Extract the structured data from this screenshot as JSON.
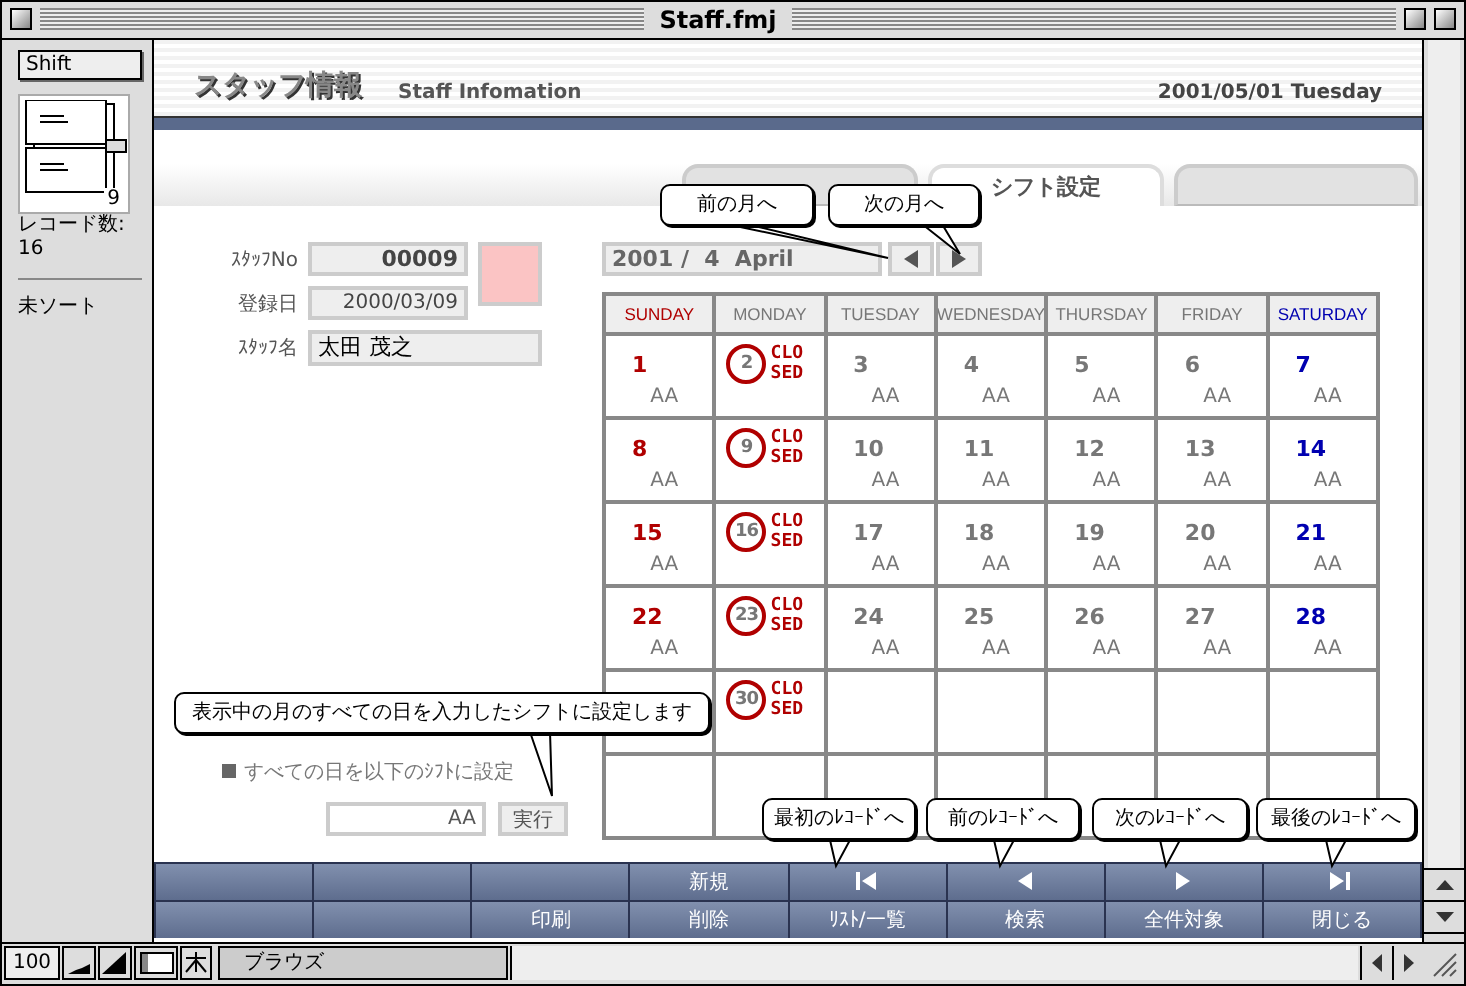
{
  "window": {
    "title": "Staff.fmj"
  },
  "status_area": {
    "layout": "Shift",
    "record": "9",
    "record_count_label": "レコード数:",
    "record_count": "16",
    "sort_status": "未ソート"
  },
  "header": {
    "title": "スタッフ情報",
    "subtitle": "Staff Infomation",
    "date": "2001/05/01 Tuesday"
  },
  "tabs": [
    {
      "selected": false
    },
    {
      "label": "シフト設定",
      "selected": true
    },
    {
      "selected": false
    }
  ],
  "form": {
    "fields": [
      {
        "kind": "id",
        "label": "ｽﾀｯﾌNo",
        "value": "00009"
      },
      {
        "kind": "date",
        "label": "登録日",
        "value": "2000/03/09"
      },
      {
        "kind": "name",
        "label": "ｽﾀｯﾌ名",
        "value": "太田 茂之"
      }
    ]
  },
  "bulk_set": {
    "label": "すべての日を以下のｼﾌﾄに設定",
    "value": "AA",
    "button": "実行"
  },
  "calendar": {
    "month": "2001 /  4  April",
    "weekdays": [
      {
        "label": "SUNDAY",
        "kind": "sunday"
      },
      {
        "label": "MONDAY",
        "kind": "weekday"
      },
      {
        "label": "TUESDAY",
        "kind": "weekday"
      },
      {
        "label": "WEDNESDAY",
        "kind": "weekday"
      },
      {
        "label": "THURSDAY",
        "kind": "weekday"
      },
      {
        "label": "FRIDAY",
        "kind": "weekday"
      },
      {
        "label": "SATURDAY",
        "kind": "saturday"
      }
    ],
    "weeks": [
      [
        {
          "day": "1",
          "shift": "AA",
          "closed": false
        },
        {
          "day": "2",
          "closed": true,
          "closed_label": "CLOSED"
        },
        {
          "day": "3",
          "shift": "AA",
          "closed": false
        },
        {
          "day": "4",
          "shift": "AA",
          "closed": false
        },
        {
          "day": "5",
          "shift": "AA",
          "closed": false
        },
        {
          "day": "6",
          "shift": "AA",
          "closed": false
        },
        {
          "day": "7",
          "shift": "AA",
          "closed": false
        }
      ],
      [
        {
          "day": "8",
          "shift": "AA",
          "closed": false
        },
        {
          "day": "9",
          "closed": true,
          "closed_label": "CLOSED"
        },
        {
          "day": "10",
          "shift": "AA",
          "closed": false
        },
        {
          "day": "11",
          "shift": "AA",
          "closed": false
        },
        {
          "day": "12",
          "shift": "AA",
          "closed": false
        },
        {
          "day": "13",
          "shift": "AA",
          "closed": false
        },
        {
          "day": "14",
          "shift": "AA",
          "closed": false
        }
      ],
      [
        {
          "day": "15",
          "shift": "AA",
          "closed": false
        },
        {
          "day": "16",
          "closed": true,
          "closed_label": "CLOSED"
        },
        {
          "day": "17",
          "shift": "AA",
          "closed": false
        },
        {
          "day": "18",
          "shift": "AA",
          "closed": false
        },
        {
          "day": "19",
          "shift": "AA",
          "closed": false
        },
        {
          "day": "20",
          "shift": "AA",
          "closed": false
        },
        {
          "day": "21",
          "shift": "AA",
          "closed": false
        }
      ],
      [
        {
          "day": "22",
          "shift": "AA",
          "closed": false
        },
        {
          "day": "23",
          "closed": true,
          "closed_label": "CLOSED"
        },
        {
          "day": "24",
          "shift": "AA",
          "closed": false
        },
        {
          "day": "25",
          "shift": "AA",
          "closed": false
        },
        {
          "day": "26",
          "shift": "AA",
          "closed": false
        },
        {
          "day": "27",
          "shift": "AA",
          "closed": false
        },
        {
          "day": "28",
          "shift": "AA",
          "closed": false
        }
      ],
      [
        {
          "closed": false
        },
        {
          "day": "30",
          "closed": true,
          "closed_label": "CLOSED"
        }
      ]
    ]
  },
  "toolbar": {
    "rows": [
      [
        {
          "kind": "blank"
        },
        {
          "kind": "blank"
        },
        {
          "kind": "blank"
        },
        {
          "kind": "text",
          "label": "新規"
        },
        {
          "kind": "first"
        },
        {
          "kind": "prev"
        },
        {
          "kind": "next"
        },
        {
          "kind": "last"
        }
      ],
      [
        {
          "kind": "blank"
        },
        {
          "kind": "blank"
        },
        {
          "kind": "text",
          "label": "印刷"
        },
        {
          "kind": "text",
          "label": "削除"
        },
        {
          "kind": "text",
          "label": "ﾘｽﾄ/一覧"
        },
        {
          "kind": "text",
          "label": "検索"
        },
        {
          "kind": "text",
          "label": "全件対象"
        },
        {
          "kind": "text",
          "label": "閉じる"
        }
      ]
    ]
  },
  "callouts": [
    {
      "text": "前の月へ"
    },
    {
      "text": "次の月へ"
    },
    {
      "text": "表示中の月のすべての日を入力したシフトに設定します"
    },
    {
      "text": "最初のﾚｺｰﾄﾞへ"
    },
    {
      "text": "前のﾚｺｰﾄﾞへ"
    },
    {
      "text": "次のﾚｺｰﾄﾞへ"
    },
    {
      "text": "最後のﾚｺｰﾄﾞへ"
    }
  ],
  "bottom_bar": {
    "zoom": "100",
    "mode": "ブラウズ"
  }
}
